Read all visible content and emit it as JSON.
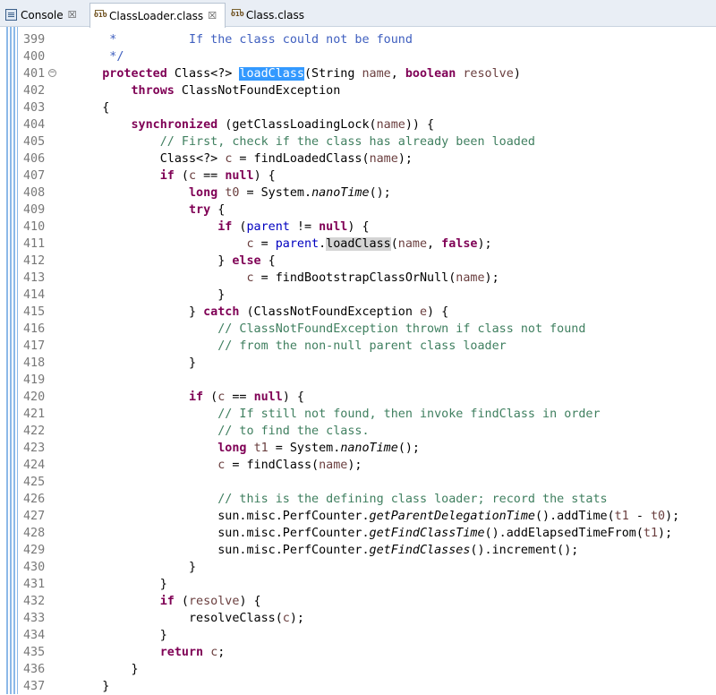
{
  "tabs": [
    {
      "label": "Console",
      "icon": "console-icon",
      "close": "☒",
      "active": false
    },
    {
      "label": "ClassLoader.class",
      "icon": "class-file-icon",
      "close": "☒",
      "active": true
    },
    {
      "label": "Class.class",
      "icon": "class-file-icon",
      "active": false
    }
  ],
  "editor": {
    "file": "ClassLoader.class",
    "selected_word": "loadClass",
    "lines": [
      {
        "n": "399",
        "tokens": [
          {
            "t": "     *          If the class could not be found",
            "c": "jd"
          }
        ]
      },
      {
        "n": "400",
        "tokens": [
          {
            "t": "     */",
            "c": "jd"
          }
        ]
      },
      {
        "n": "401",
        "fold": "−",
        "tokens": [
          {
            "t": "    "
          },
          {
            "t": "protected",
            "c": "kw"
          },
          {
            "t": " Class<?> "
          },
          {
            "t": "loadClass",
            "c": "sel"
          },
          {
            "t": "(String "
          },
          {
            "t": "name",
            "c": "lv"
          },
          {
            "t": ", "
          },
          {
            "t": "boolean",
            "c": "kw"
          },
          {
            "t": " "
          },
          {
            "t": "resolve",
            "c": "lv"
          },
          {
            "t": ")"
          }
        ]
      },
      {
        "n": "402",
        "tokens": [
          {
            "t": "        "
          },
          {
            "t": "throws",
            "c": "kw"
          },
          {
            "t": " ClassNotFoundException"
          }
        ]
      },
      {
        "n": "403",
        "tokens": [
          {
            "t": "    {"
          }
        ]
      },
      {
        "n": "404",
        "tokens": [
          {
            "t": "        "
          },
          {
            "t": "synchronized",
            "c": "kw"
          },
          {
            "t": " (getClassLoadingLock("
          },
          {
            "t": "name",
            "c": "lv"
          },
          {
            "t": ")) {"
          }
        ]
      },
      {
        "n": "405",
        "tokens": [
          {
            "t": "            "
          },
          {
            "t": "// First, check if the class has already been loaded",
            "c": "cm"
          }
        ]
      },
      {
        "n": "406",
        "tokens": [
          {
            "t": "            Class<?> "
          },
          {
            "t": "c",
            "c": "lv"
          },
          {
            "t": " = findLoadedClass("
          },
          {
            "t": "name",
            "c": "lv"
          },
          {
            "t": ");"
          }
        ]
      },
      {
        "n": "407",
        "tokens": [
          {
            "t": "            "
          },
          {
            "t": "if",
            "c": "kw"
          },
          {
            "t": " ("
          },
          {
            "t": "c",
            "c": "lv"
          },
          {
            "t": " == "
          },
          {
            "t": "null",
            "c": "kw"
          },
          {
            "t": ") {"
          }
        ]
      },
      {
        "n": "408",
        "tokens": [
          {
            "t": "                "
          },
          {
            "t": "long",
            "c": "kw"
          },
          {
            "t": " "
          },
          {
            "t": "t0",
            "c": "lv"
          },
          {
            "t": " = System."
          },
          {
            "t": "nanoTime",
            "c": "it"
          },
          {
            "t": "();"
          }
        ]
      },
      {
        "n": "409",
        "tokens": [
          {
            "t": "                "
          },
          {
            "t": "try",
            "c": "kw"
          },
          {
            "t": " {"
          }
        ]
      },
      {
        "n": "410",
        "tokens": [
          {
            "t": "                    "
          },
          {
            "t": "if",
            "c": "kw"
          },
          {
            "t": " ("
          },
          {
            "t": "parent",
            "c": "fld"
          },
          {
            "t": " != "
          },
          {
            "t": "null",
            "c": "kw"
          },
          {
            "t": ") {"
          }
        ]
      },
      {
        "n": "411",
        "tokens": [
          {
            "t": "                        "
          },
          {
            "t": "c",
            "c": "lv"
          },
          {
            "t": " = "
          },
          {
            "t": "parent",
            "c": "fld"
          },
          {
            "t": "."
          },
          {
            "t": "loadClass",
            "c": "occ"
          },
          {
            "t": "("
          },
          {
            "t": "name",
            "c": "lv"
          },
          {
            "t": ", "
          },
          {
            "t": "false",
            "c": "kw"
          },
          {
            "t": ");"
          }
        ]
      },
      {
        "n": "412",
        "tokens": [
          {
            "t": "                    } "
          },
          {
            "t": "else",
            "c": "kw"
          },
          {
            "t": " {"
          }
        ]
      },
      {
        "n": "413",
        "tokens": [
          {
            "t": "                        "
          },
          {
            "t": "c",
            "c": "lv"
          },
          {
            "t": " = findBootstrapClassOrNull("
          },
          {
            "t": "name",
            "c": "lv"
          },
          {
            "t": ");"
          }
        ]
      },
      {
        "n": "414",
        "tokens": [
          {
            "t": "                    }"
          }
        ]
      },
      {
        "n": "415",
        "tokens": [
          {
            "t": "                } "
          },
          {
            "t": "catch",
            "c": "kw"
          },
          {
            "t": " (ClassNotFoundException "
          },
          {
            "t": "e",
            "c": "lv"
          },
          {
            "t": ") {"
          }
        ]
      },
      {
        "n": "416",
        "tokens": [
          {
            "t": "                    "
          },
          {
            "t": "// ClassNotFoundException thrown if class not found",
            "c": "cm"
          }
        ]
      },
      {
        "n": "417",
        "tokens": [
          {
            "t": "                    "
          },
          {
            "t": "// from the non-null parent class loader",
            "c": "cm"
          }
        ]
      },
      {
        "n": "418",
        "tokens": [
          {
            "t": "                }"
          }
        ]
      },
      {
        "n": "419",
        "tokens": [
          {
            "t": ""
          }
        ]
      },
      {
        "n": "420",
        "tokens": [
          {
            "t": "                "
          },
          {
            "t": "if",
            "c": "kw"
          },
          {
            "t": " ("
          },
          {
            "t": "c",
            "c": "lv"
          },
          {
            "t": " == "
          },
          {
            "t": "null",
            "c": "kw"
          },
          {
            "t": ") {"
          }
        ]
      },
      {
        "n": "421",
        "tokens": [
          {
            "t": "                    "
          },
          {
            "t": "// If still not found, then invoke findClass in order",
            "c": "cm"
          }
        ]
      },
      {
        "n": "422",
        "tokens": [
          {
            "t": "                    "
          },
          {
            "t": "// to find the class.",
            "c": "cm"
          }
        ]
      },
      {
        "n": "423",
        "tokens": [
          {
            "t": "                    "
          },
          {
            "t": "long",
            "c": "kw"
          },
          {
            "t": " "
          },
          {
            "t": "t1",
            "c": "lv"
          },
          {
            "t": " = System."
          },
          {
            "t": "nanoTime",
            "c": "it"
          },
          {
            "t": "();"
          }
        ]
      },
      {
        "n": "424",
        "tokens": [
          {
            "t": "                    "
          },
          {
            "t": "c",
            "c": "lv"
          },
          {
            "t": " = findClass("
          },
          {
            "t": "name",
            "c": "lv"
          },
          {
            "t": ");"
          }
        ]
      },
      {
        "n": "425",
        "tokens": [
          {
            "t": ""
          }
        ]
      },
      {
        "n": "426",
        "tokens": [
          {
            "t": "                    "
          },
          {
            "t": "// this is the defining class loader; record the stats",
            "c": "cm"
          }
        ]
      },
      {
        "n": "427",
        "tokens": [
          {
            "t": "                    sun.misc.PerfCounter."
          },
          {
            "t": "getParentDelegationTime",
            "c": "it"
          },
          {
            "t": "().addTime("
          },
          {
            "t": "t1",
            "c": "lv"
          },
          {
            "t": " - "
          },
          {
            "t": "t0",
            "c": "lv"
          },
          {
            "t": ");"
          }
        ]
      },
      {
        "n": "428",
        "tokens": [
          {
            "t": "                    sun.misc.PerfCounter."
          },
          {
            "t": "getFindClassTime",
            "c": "it"
          },
          {
            "t": "().addElapsedTimeFrom("
          },
          {
            "t": "t1",
            "c": "lv"
          },
          {
            "t": ");"
          }
        ]
      },
      {
        "n": "429",
        "tokens": [
          {
            "t": "                    sun.misc.PerfCounter."
          },
          {
            "t": "getFindClasses",
            "c": "it"
          },
          {
            "t": "().increment();"
          }
        ]
      },
      {
        "n": "430",
        "tokens": [
          {
            "t": "                }"
          }
        ]
      },
      {
        "n": "431",
        "tokens": [
          {
            "t": "            }"
          }
        ]
      },
      {
        "n": "432",
        "tokens": [
          {
            "t": "            "
          },
          {
            "t": "if",
            "c": "kw"
          },
          {
            "t": " ("
          },
          {
            "t": "resolve",
            "c": "lv"
          },
          {
            "t": ") {"
          }
        ]
      },
      {
        "n": "433",
        "tokens": [
          {
            "t": "                resolveClass("
          },
          {
            "t": "c",
            "c": "lv"
          },
          {
            "t": ");"
          }
        ]
      },
      {
        "n": "434",
        "tokens": [
          {
            "t": "            }"
          }
        ]
      },
      {
        "n": "435",
        "tokens": [
          {
            "t": "            "
          },
          {
            "t": "return",
            "c": "kw"
          },
          {
            "t": " "
          },
          {
            "t": "c",
            "c": "lv"
          },
          {
            "t": ";"
          }
        ]
      },
      {
        "n": "436",
        "tokens": [
          {
            "t": "        }"
          }
        ]
      },
      {
        "n": "437",
        "tokens": [
          {
            "t": "    }"
          }
        ]
      }
    ]
  }
}
